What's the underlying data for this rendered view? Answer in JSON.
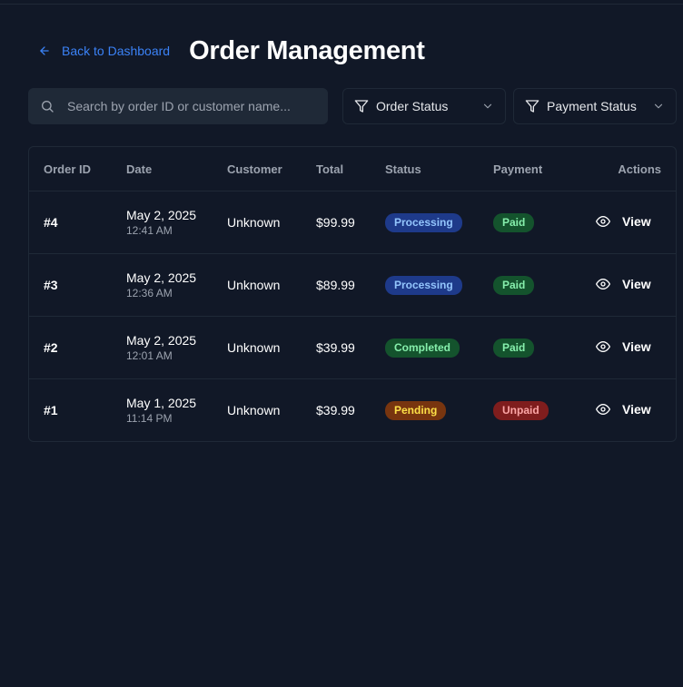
{
  "header": {
    "back_label": "Back to Dashboard",
    "title": "Order Management"
  },
  "search": {
    "placeholder": "Search by order ID or customer name..."
  },
  "filters": {
    "order_status_label": "Order Status",
    "payment_status_label": "Payment Status"
  },
  "table": {
    "columns": [
      "Order ID",
      "Date",
      "Customer",
      "Total",
      "Status",
      "Payment",
      "Actions"
    ],
    "rows": [
      {
        "id": "#4",
        "date": "May 2, 2025",
        "time": "12:41 AM",
        "customer": "Unknown",
        "total": "$99.99",
        "status": "Processing",
        "payment": "Paid",
        "action": "View"
      },
      {
        "id": "#3",
        "date": "May 2, 2025",
        "time": "12:36 AM",
        "customer": "Unknown",
        "total": "$89.99",
        "status": "Processing",
        "payment": "Paid",
        "action": "View"
      },
      {
        "id": "#2",
        "date": "May 2, 2025",
        "time": "12:01 AM",
        "customer": "Unknown",
        "total": "$39.99",
        "status": "Completed",
        "payment": "Paid",
        "action": "View"
      },
      {
        "id": "#1",
        "date": "May 1, 2025",
        "time": "11:14 PM",
        "customer": "Unknown",
        "total": "$39.99",
        "status": "Pending",
        "payment": "Unpaid",
        "action": "View"
      }
    ]
  },
  "badge_colors": {
    "Processing": {
      "bg": "#1e3a8a",
      "fg": "#93c5fd"
    },
    "Completed": {
      "bg": "#14532d",
      "fg": "#86efac"
    },
    "Pending": {
      "bg": "#78350f",
      "fg": "#fde047"
    },
    "Paid": {
      "bg": "#14532d",
      "fg": "#86efac"
    },
    "Unpaid": {
      "bg": "#7f1d1d",
      "fg": "#fca5a5"
    }
  },
  "colors": {
    "background": "#111827",
    "accent": "#3b82f6",
    "border": "#1f2937"
  },
  "icons": {
    "back": "arrow-left-icon",
    "search": "search-icon",
    "filter": "filter-icon",
    "chevron": "chevron-down-icon",
    "view": "eye-icon"
  }
}
